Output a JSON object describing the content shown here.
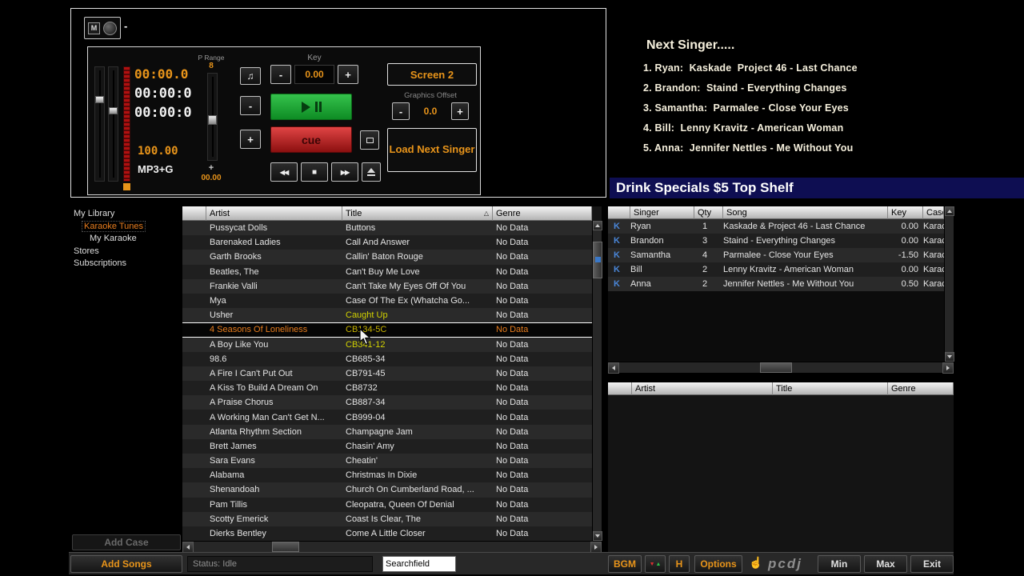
{
  "deck": {
    "mini": {
      "m": "M",
      "dash": "-"
    },
    "times": {
      "t1": "00:00.0",
      "t2": "00:00:0",
      "t3": "00:00:0"
    },
    "tempo": "100.00",
    "format": "MP3+G",
    "p_range": {
      "label": "P Range",
      "value": "8",
      "plus": "+",
      "bottom": "00.00"
    },
    "note_icon": "♫",
    "minus": "-",
    "plus": "+",
    "key": {
      "label": "Key",
      "minus": "-",
      "value": "0.00",
      "plus": "+"
    },
    "cue": "cue",
    "transport": {
      "rew": "◀◀",
      "stop": "■",
      "ffwd": "▶▶"
    },
    "screen2": "Screen 2",
    "graphics_offset": {
      "label": "Graphics Offset",
      "minus": "-",
      "value": "0.0",
      "plus": "+"
    },
    "load_next": "Load Next Singer"
  },
  "next_singer": {
    "title": "Next Singer.....",
    "entries": [
      "1. Ryan:  Kaskade  Project 46 - Last Chance",
      "2. Brandon:  Staind - Everything Changes",
      "3. Samantha:  Parmalee - Close Your Eyes",
      "4. Bill:  Lenny Kravitz - American Woman",
      "5. Anna:  Jennifer Nettles - Me Without You"
    ]
  },
  "ticker": {
    "text": "Drink Specials $5 Top Shelf"
  },
  "sidebar": {
    "root": "My Library",
    "items": [
      {
        "label": "Karaoke Tunes",
        "selected": true
      },
      {
        "label": "My Karaoke",
        "selected": false
      },
      {
        "label": "Stores",
        "selected": false
      },
      {
        "label": "Subscriptions",
        "selected": false
      }
    ],
    "add_case": "Add Case"
  },
  "library": {
    "headers": [
      "",
      "Artist",
      "Title",
      "Genre"
    ],
    "sort_indicator": "△",
    "rows": [
      {
        "artist": "Pussycat Dolls",
        "title": "Buttons",
        "genre": "No Data"
      },
      {
        "artist": "Barenaked Ladies",
        "title": "Call And Answer",
        "genre": "No Data"
      },
      {
        "artist": "Garth Brooks",
        "title": "Callin' Baton Rouge",
        "genre": "No Data"
      },
      {
        "artist": "Beatles, The",
        "title": "Can't Buy Me Love",
        "genre": "No Data"
      },
      {
        "artist": "Frankie Valli",
        "title": "Can't Take My Eyes Off Of You",
        "genre": "No Data"
      },
      {
        "artist": "Mya",
        "title": "Case Of The Ex (Whatcha Go...",
        "genre": "No Data"
      },
      {
        "artist": "Usher",
        "title": "Caught Up",
        "genre": "No Data",
        "title_class": "hl"
      },
      {
        "artist": "4 Seasons Of Loneliness",
        "title": "CB134-5C",
        "genre": "No Data",
        "row_class": "selected",
        "title_class": "hl"
      },
      {
        "artist": "A Boy Like You",
        "title": "CB341-12",
        "genre": "No Data",
        "title_class": "hl"
      },
      {
        "artist": "98.6",
        "title": "CB685-34",
        "genre": "No Data"
      },
      {
        "artist": "A Fire I Can't Put Out",
        "title": "CB791-45",
        "genre": "No Data"
      },
      {
        "artist": "A Kiss To Build A Dream On",
        "title": "CB8732",
        "genre": "No Data"
      },
      {
        "artist": "A Praise Chorus",
        "title": "CB887-34",
        "genre": "No Data"
      },
      {
        "artist": "A Working Man Can't Get N...",
        "title": "CB999-04",
        "genre": "No Data"
      },
      {
        "artist": "Atlanta Rhythm Section",
        "title": "Champagne Jam",
        "genre": "No Data"
      },
      {
        "artist": "Brett James",
        "title": "Chasin' Amy",
        "genre": "No Data"
      },
      {
        "artist": "Sara Evans",
        "title": "Cheatin'",
        "genre": "No Data"
      },
      {
        "artist": "Alabama",
        "title": "Christmas In Dixie",
        "genre": "No Data"
      },
      {
        "artist": "Shenandoah",
        "title": "Church On Cumberland Road, ...",
        "genre": "No Data"
      },
      {
        "artist": "Pam Tillis",
        "title": "Cleopatra, Queen Of Denial",
        "genre": "No Data"
      },
      {
        "artist": "Scotty Emerick",
        "title": "Coast Is Clear, The",
        "genre": "No Data"
      },
      {
        "artist": "Dierks Bentley",
        "title": "Come A Little Closer",
        "genre": "No Data"
      }
    ]
  },
  "queue": {
    "headers": [
      "",
      "Singer",
      "Qty",
      "Song",
      "Key",
      "Case"
    ],
    "rows": [
      {
        "mark": "K",
        "singer": "Ryan",
        "qty": "1",
        "song": "Kaskade & Project 46 - Last Chance",
        "key": "0.00",
        "case": "Karac"
      },
      {
        "mark": "K",
        "singer": "Brandon",
        "qty": "3",
        "song": "Staind - Everything Changes",
        "key": "0.00",
        "case": "Karac"
      },
      {
        "mark": "K",
        "singer": "Samantha",
        "qty": "4",
        "song": "Parmalee - Close Your Eyes",
        "key": "-1.50",
        "case": "Karac"
      },
      {
        "mark": "K",
        "singer": "Bill",
        "qty": "2",
        "song": "Lenny Kravitz - American Woman",
        "key": "0.00",
        "case": "Karac"
      },
      {
        "mark": "K",
        "singer": "Anna",
        "qty": "2",
        "song": "Jennifer Nettles - Me Without You",
        "key": "0.50",
        "case": "Karac"
      }
    ]
  },
  "bottom_table": {
    "headers": [
      "",
      "Artist",
      "Title",
      "Genre"
    ]
  },
  "statusbar": {
    "add_songs": "Add Songs",
    "status": "Status: Idle",
    "search": "Searchfield",
    "bgm": "BGM",
    "h_icon": "H",
    "options": "Options",
    "hand": "☝",
    "logo": "pcdj",
    "min": "Min",
    "max": "Max",
    "exit": "Exit"
  },
  "colors": {
    "accent_orange": "#e8941a",
    "selected_orange": "#e87d1e",
    "highlight_yellow": "#d2d200",
    "queue_mark_blue": "#4a86d8",
    "ticker_navy": "#0e0e52",
    "play_green": "#1faf3a",
    "cue_red": "#c02020"
  }
}
